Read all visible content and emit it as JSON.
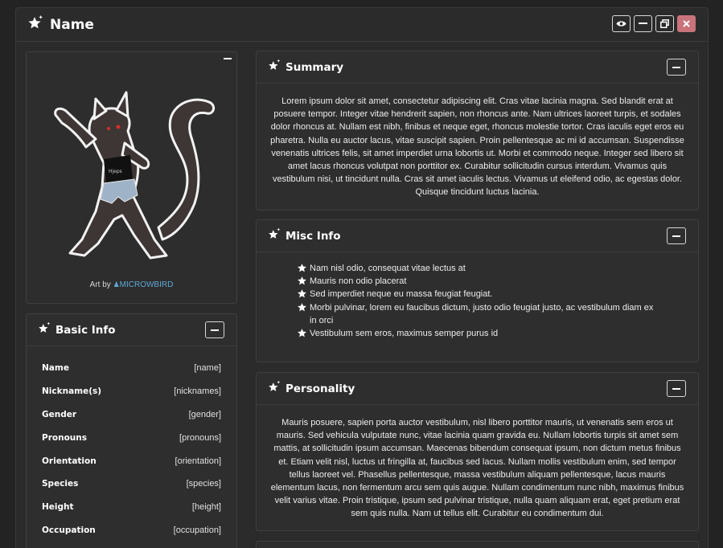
{
  "window": {
    "title": "Name",
    "controls": [
      "eye-icon",
      "minimize-icon",
      "restore-icon",
      "close-icon"
    ],
    "close_color": "#c9737a"
  },
  "art": {
    "credit_prefix": "Art by",
    "artist": "MICROWBIRD",
    "artist_color": "#5ea9d6"
  },
  "summary": {
    "title": "Summary",
    "text": "Lorem ipsum dolor sit amet, consectetur adipiscing elit. Cras vitae lacinia magna. Sed blandit erat at posuere tempor. Integer vitae hendrerit sapien, non rhoncus ante. Nam ultrices laoreet turpis, et sodales dolor rhoncus at. Nullam est nibh, finibus et neque eget, rhoncus molestie tortor. Cras iaculis eget eros eu pharetra. Nulla eu auctor lacus, vitae suscipit sapien. Proin pellentesque ac mi id accumsan. Suspendisse venenatis ultrices felis, sit amet imperdiet urna lobortis ut. Morbi et commodo neque. Integer sed libero sit amet lacus rhoncus volutpat non porttitor ex. Curabitur sollicitudin cursus interdum. Vivamus quis vestibulum nisi, ut tincidunt nulla. Cras sit amet iaculis lectus. Vivamus ut eleifend odio, ac egestas dolor. Quisque tincidunt luctus lacinia."
  },
  "misc": {
    "title": "Misc Info",
    "items": [
      "Nam nisl odio, consequat vitae lectus at",
      "Mauris non odio placerat",
      "Sed imperdiet neque eu massa feugiat feugiat.",
      "Morbi pulvinar, lorem eu faucibus dictum, justo odio feugiat justo, ac vestibulum diam ex in orci",
      "Vestibulum sem eros, maximus semper purus id"
    ]
  },
  "personality": {
    "title": "Personality",
    "text": "Mauris posuere, sapien porta auctor vestibulum, nisl libero porttitor mauris, ut venenatis sem eros ut mauris. Sed vehicula vulputate nunc, vitae lacinia quam gravida eu. Nullam lobortis turpis sit amet sem mattis, at sollicitudin ipsum accumsan. Maecenas bibendum consequat ipsum, non dictum metus finibus et. Etiam velit nisl, luctus ut fringilla at, faucibus sed lacus. Nullam mollis vestibulum enim, sed tempor tellus laoreet vel. Phasellus pellentesque, massa vestibulum aliquam pellentesque, lacus mauris elementum lacus, non fermentum arcu sem quis augue. Nullam condimentum nunc nibh, maximus finibus velit varius vitae. Proin tristique, ipsum sed pulvinar tristique, nulla quam aliquam erat, eget pretium erat sem quis nulla. Nam ut tellus elit. Curabitur eu condimentum dui."
  },
  "basic_info": {
    "title": "Basic Info",
    "rows": [
      {
        "key": "Name",
        "value": "[name]"
      },
      {
        "key": "Nickname(s)",
        "value": "[nicknames]"
      },
      {
        "key": "Gender",
        "value": "[gender]"
      },
      {
        "key": "Pronouns",
        "value": "[pronouns]"
      },
      {
        "key": "Orientation",
        "value": "[orientation]"
      },
      {
        "key": "Species",
        "value": "[species]"
      },
      {
        "key": "Height",
        "value": "[height]"
      },
      {
        "key": "Occupation",
        "value": "[occupation]"
      }
    ]
  }
}
